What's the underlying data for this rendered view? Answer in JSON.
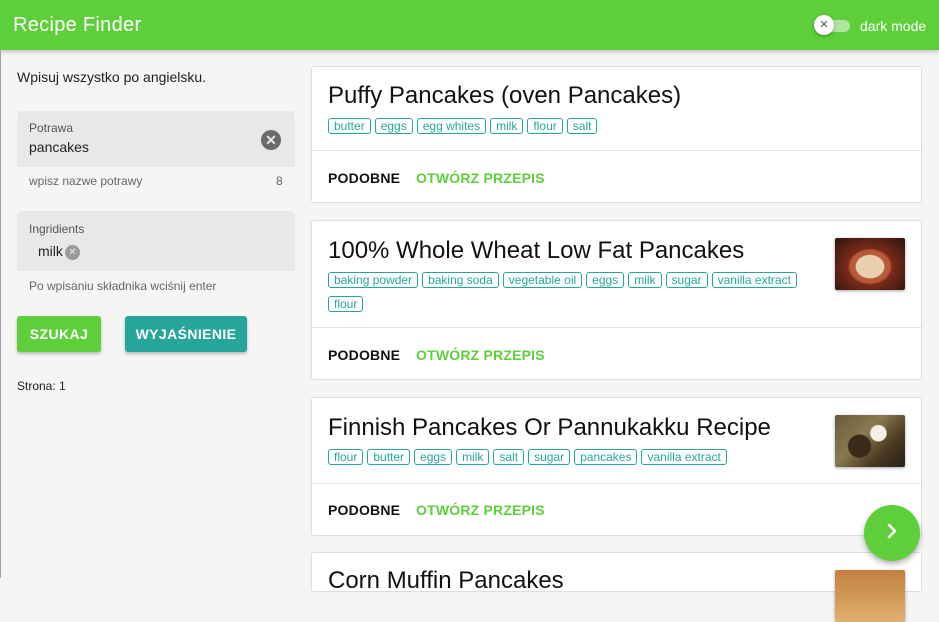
{
  "app": {
    "title": "Recipe Finder",
    "dark_mode_label": "dark mode",
    "switch_icon": "✕"
  },
  "sidebar": {
    "hint": "Wpisuj wszystko po angielsku.",
    "dish_field": {
      "label": "Potrawa",
      "value": "pancakes",
      "helper": "wpisz nazwe potrawy",
      "counter": "8"
    },
    "ingredients_field": {
      "label": "Ingridients",
      "chips": [
        "milk"
      ],
      "helper": "Po wpisaniu składnika wciśnij enter"
    },
    "search_label": "SZUKAJ",
    "explain_label": "WYJAŚNIENIE",
    "page_label": "Strona: 1"
  },
  "actions": {
    "similar": "PODOBNE",
    "open": "OTWÓRZ PRZEPIS"
  },
  "recipes": [
    {
      "title": "Puffy Pancakes (oven Pancakes)",
      "ingredients": [
        "butter",
        "eggs",
        "egg whites",
        "milk",
        "flour",
        "salt"
      ]
    },
    {
      "title": "100% Whole Wheat Low Fat Pancakes",
      "ingredients": [
        "baking powder",
        "baking soda",
        "vegetable oil",
        "eggs",
        "milk",
        "sugar",
        "vanilla extract",
        "flour"
      ]
    },
    {
      "title": "Finnish Pancakes Or Pannukakku Recipe",
      "ingredients": [
        "flour",
        "butter",
        "eggs",
        "milk",
        "salt",
        "sugar",
        "pancakes",
        "vanilla extract"
      ]
    },
    {
      "title": "Corn Muffin Pancakes",
      "ingredients": []
    }
  ],
  "colors": {
    "primary": "#5ecf3a",
    "secondary": "#26a69a"
  },
  "icons": {
    "clear": "✕",
    "next": "chevron-right-icon"
  }
}
